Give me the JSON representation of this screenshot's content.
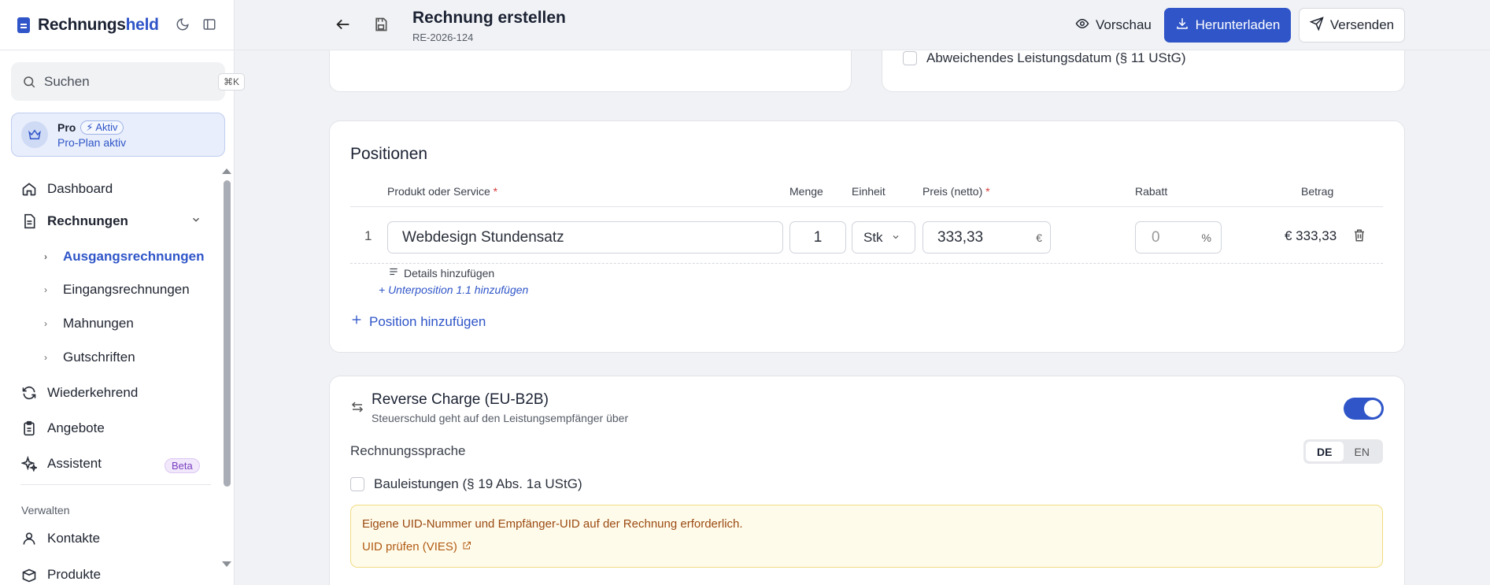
{
  "sidebar": {
    "brand": {
      "prefix": "Rechnungs",
      "suffix": "held"
    },
    "search": {
      "placeholder": "Suchen",
      "shortcut": "⌘K"
    },
    "plan": {
      "name": "Pro",
      "badge": "Aktiv",
      "subtitle": "Pro-Plan aktiv"
    },
    "nav": {
      "dashboard": "Dashboard",
      "rechnungen": "Rechnungen",
      "sub": {
        "ausgang": "Ausgangsrechnungen",
        "eingang": "Eingangsrechnungen",
        "mahnungen": "Mahnungen",
        "gutschriften": "Gutschriften"
      },
      "wiederkehrend": "Wiederkehrend",
      "angebote": "Angebote",
      "assistent": "Assistent",
      "assistent_badge": "Beta",
      "section_manage": "Verwalten",
      "kontakte": "Kontakte",
      "produkte": "Produkte"
    }
  },
  "header": {
    "title": "Rechnung erstellen",
    "number": "RE-2026-124",
    "preview": "Vorschau",
    "download": "Herunterladen",
    "send": "Versenden"
  },
  "dates": {
    "different_service_date": "Abweichendes Leistungsdatum (§ 11 UStG)"
  },
  "positions": {
    "title": "Positionen",
    "columns": {
      "product": "Produkt oder Service",
      "qty": "Menge",
      "unit": "Einheit",
      "price": "Preis (netto)",
      "discount": "Rabatt",
      "amount": "Betrag"
    },
    "rows": [
      {
        "index": "1",
        "product": "Webdesign Stundensatz",
        "qty": "1",
        "unit": "Stk",
        "price": "333,33",
        "currency": "€",
        "discount_placeholder": "0",
        "discount_unit": "%",
        "amount": "€ 333,33"
      }
    ],
    "add_details": "Details hinzufügen",
    "add_subposition": "+ Unterposition 1.1 hinzufügen",
    "add_position": "Position hinzufügen"
  },
  "reverse_charge": {
    "title": "Reverse Charge (EU-B2B)",
    "subtitle": "Steuerschuld geht auf den Leistungsempfänger über",
    "enabled": true,
    "language_label": "Rechnungssprache",
    "languages": [
      "DE",
      "EN"
    ],
    "selected_language": "DE",
    "construction_label": "Bauleistungen (§ 19 Abs. 1a UStG)",
    "notice": "Eigene UID-Nummer und Empfänger-UID auf der Rechnung erforderlich.",
    "notice_link": "UID prüfen (VIES)"
  },
  "colors": {
    "accent": "#2f55c8",
    "notice_bg": "#fffbea",
    "notice_text": "#9a4a12",
    "beta": "#7a3fc1"
  }
}
